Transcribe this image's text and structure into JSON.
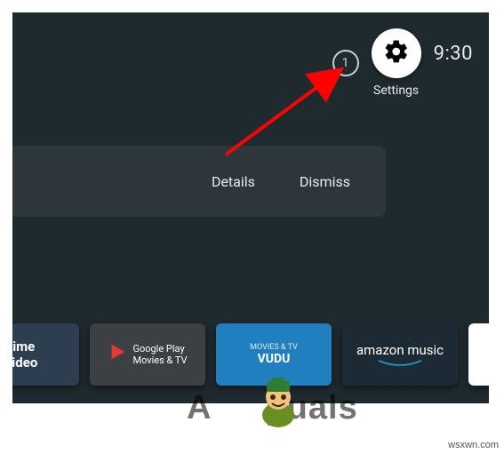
{
  "status": {
    "notification_count": "1",
    "settings_label": "Settings",
    "clock": "9:30"
  },
  "notification_panel": {
    "details_label": "Details",
    "dismiss_label": "Dismiss"
  },
  "apps": {
    "prime_video": {
      "line1": "rime",
      "line2": "video"
    },
    "google_play": {
      "line1": "Google Play",
      "line2": "Movies & TV"
    },
    "vudu": {
      "tag": "MOVIES & TV",
      "brand": "VUDU"
    },
    "amazon_music": {
      "label": "amazon music"
    }
  },
  "annotation": {
    "watermark_left": "A",
    "watermark_right": "puals",
    "source": "wsxwn.com"
  }
}
